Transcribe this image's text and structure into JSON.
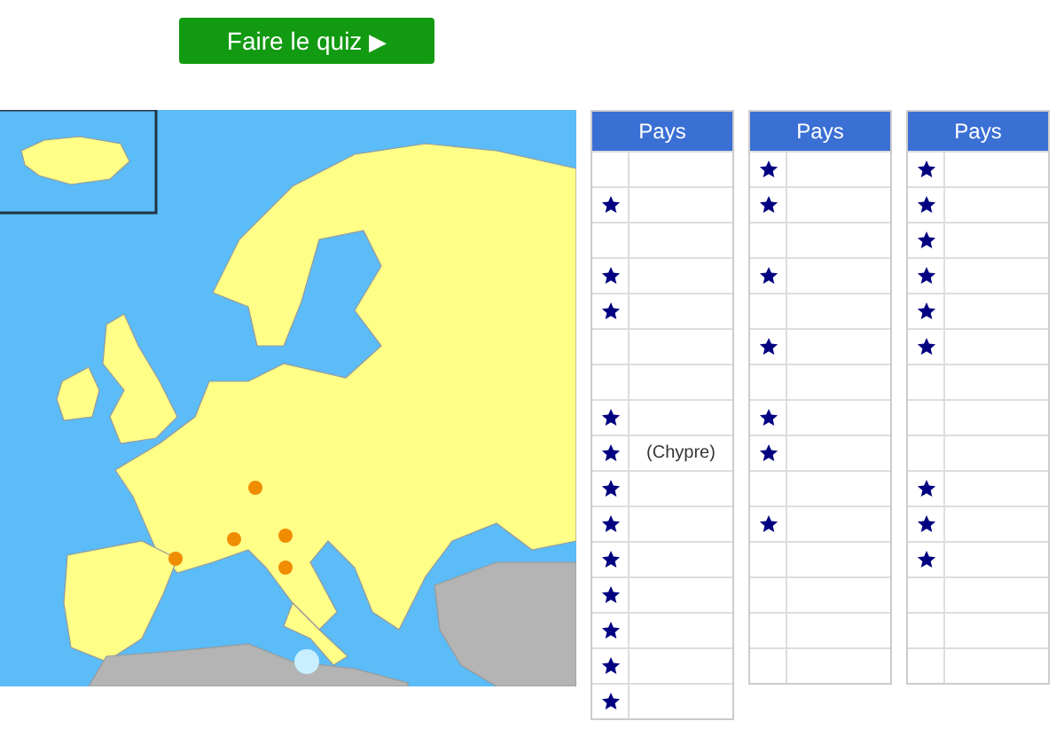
{
  "quiz_button": {
    "label": "Faire le quiz",
    "icon": "▶"
  },
  "tables": [
    {
      "header": "Pays",
      "rows": [
        {
          "starred": false
        },
        {
          "starred": true
        },
        {
          "starred": false
        },
        {
          "starred": true
        },
        {
          "starred": true
        },
        {
          "starred": false
        },
        {
          "starred": false
        },
        {
          "starred": true
        },
        {
          "starred": true,
          "country": "(Chypre)"
        },
        {
          "starred": true
        },
        {
          "starred": true
        },
        {
          "starred": true
        },
        {
          "starred": true
        },
        {
          "starred": true
        },
        {
          "starred": true
        },
        {
          "starred": true
        }
      ]
    },
    {
      "header": "Pays",
      "rows": [
        {
          "starred": true
        },
        {
          "starred": true
        },
        {
          "starred": false
        },
        {
          "starred": true
        },
        {
          "starred": false
        },
        {
          "starred": true
        },
        {
          "starred": false
        },
        {
          "starred": true
        },
        {
          "starred": true
        },
        {
          "starred": false
        },
        {
          "starred": true
        },
        {
          "starred": false
        },
        {
          "starred": false
        },
        {
          "starred": false
        },
        {
          "starred": false
        }
      ]
    },
    {
      "header": "Pays",
      "rows": [
        {
          "starred": true
        },
        {
          "starred": true
        },
        {
          "starred": true
        },
        {
          "starred": true
        },
        {
          "starred": true
        },
        {
          "starred": true
        },
        {
          "starred": false
        },
        {
          "starred": false
        },
        {
          "starred": false
        },
        {
          "starred": true
        },
        {
          "starred": true
        },
        {
          "starred": true
        },
        {
          "starred": false
        },
        {
          "starred": false
        },
        {
          "starred": false
        }
      ]
    }
  ]
}
